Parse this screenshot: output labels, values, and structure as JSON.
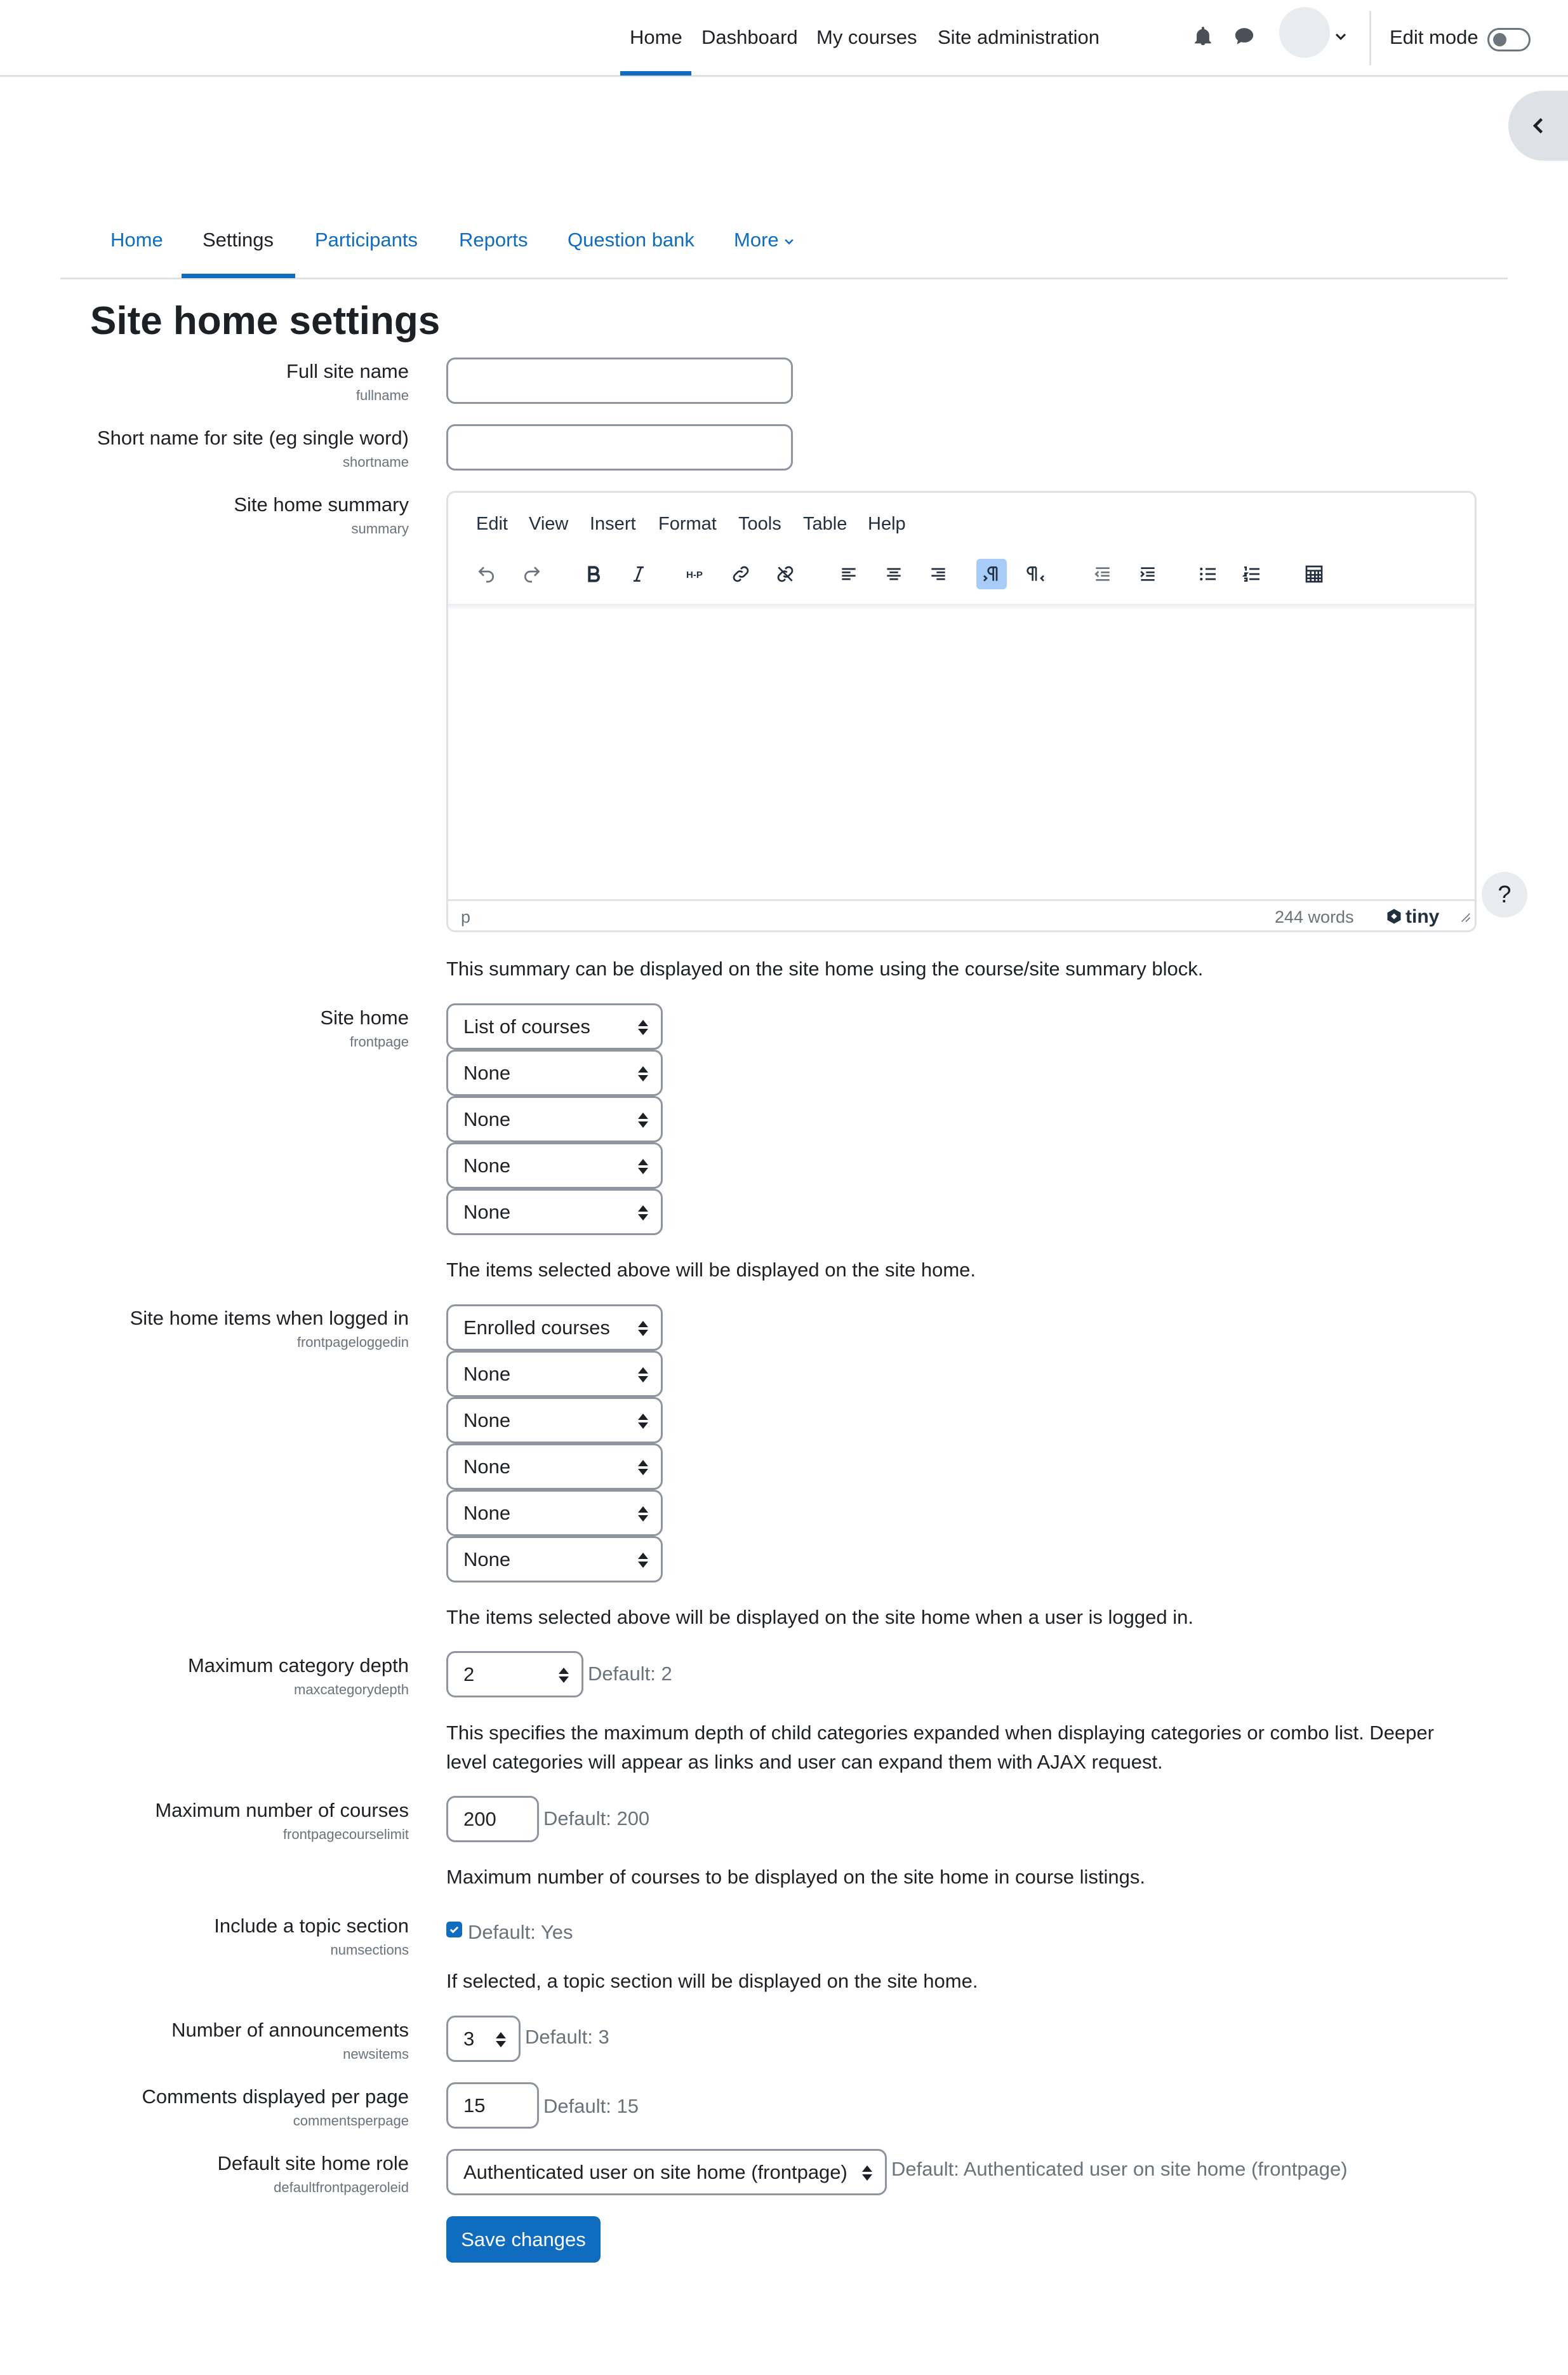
{
  "navbar": {
    "links": [
      "Home",
      "Dashboard",
      "My courses",
      "Site administration"
    ],
    "edit_mode_label": "Edit mode"
  },
  "secondary_nav": {
    "tabs": [
      "Home",
      "Settings",
      "Participants",
      "Reports",
      "Question bank",
      "More"
    ],
    "active_tab": "Settings"
  },
  "page_title": "Site home settings",
  "fields": {
    "fullname": {
      "label": "Full site name",
      "name": "fullname",
      "value": ""
    },
    "shortname": {
      "label": "Short name for site (eg single word)",
      "name": "shortname",
      "value": ""
    },
    "summary": {
      "label": "Site home summary",
      "name": "summary",
      "editor_menu": [
        "Edit",
        "View",
        "Insert",
        "Format",
        "Tools",
        "Table",
        "Help"
      ],
      "status_path": "p",
      "word_count": "244 words",
      "brand": "tiny",
      "help": "This summary can be displayed on the site home using the course/site summary block."
    },
    "frontpage": {
      "label": "Site home",
      "name": "frontpage",
      "values": [
        "List of courses",
        "None",
        "None",
        "None",
        "None"
      ],
      "help": "The items selected above will be displayed on the site home."
    },
    "frontpageloggedin": {
      "label": "Site home items when logged in",
      "name": "frontpageloggedin",
      "values": [
        "Enrolled courses",
        "None",
        "None",
        "None",
        "None",
        "None"
      ],
      "help": "The items selected above will be displayed on the site home when a user is logged in."
    },
    "maxcategorydepth": {
      "label": "Maximum category depth",
      "name": "maxcategorydepth",
      "value": "2",
      "default": "Default: 2",
      "help": "This specifies the maximum depth of child categories expanded when displaying categories or combo list. Deeper level categories will appear as links and user can expand them with AJAX request."
    },
    "frontpagecourselimit": {
      "label": "Maximum number of courses",
      "name": "frontpagecourselimit",
      "value": "200",
      "default": "Default: 200",
      "help": "Maximum number of courses to be displayed on the site home in course listings."
    },
    "numsections": {
      "label": "Include a topic section",
      "name": "numsections",
      "checked": true,
      "default": "Default: Yes",
      "help": "If selected, a topic section will be displayed on the site home."
    },
    "newsitems": {
      "label": "Number of announcements",
      "name": "newsitems",
      "value": "3",
      "default": "Default: 3"
    },
    "commentsperpage": {
      "label": "Comments displayed per page",
      "name": "commentsperpage",
      "value": "15",
      "default": "Default: 15"
    },
    "defaultfrontpageroleid": {
      "label": "Default site home role",
      "name": "defaultfrontpageroleid",
      "value": "Authenticated user on site home (frontpage)",
      "default": "Default: Authenticated user on site home (frontpage)"
    }
  },
  "save_button": "Save changes",
  "help_button": "?",
  "colors": {
    "primary": "#0f6cbf",
    "text": "#1d2125",
    "muted": "#6a737b",
    "border": "#8f959e"
  }
}
